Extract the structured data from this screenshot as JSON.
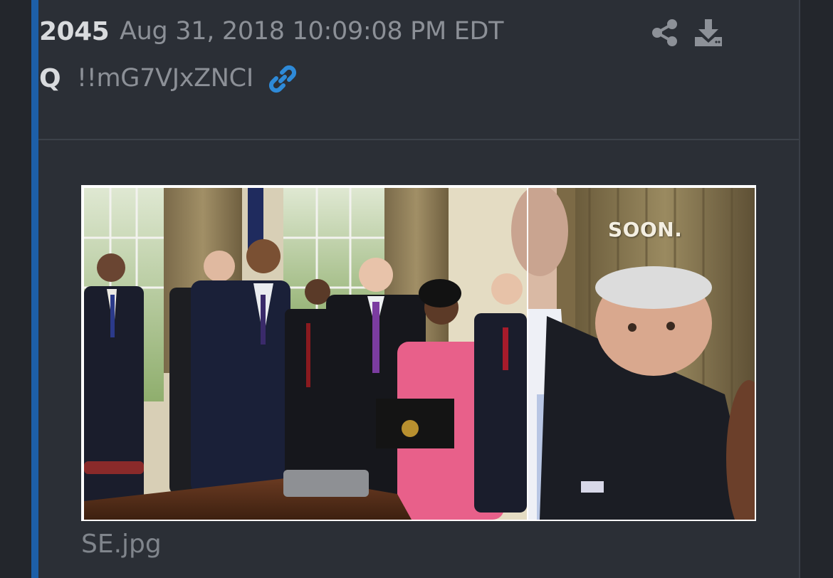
{
  "post": {
    "number": "2045",
    "date": "Aug 31, 2018 10:09:08 PM EDT",
    "author": "Q",
    "tripcode": "!!mG7VJxZNCI"
  },
  "icons": {
    "link": "link-icon",
    "share": "share-icon",
    "download": "download-icon"
  },
  "attachment": {
    "overlay_text": "SOON.",
    "filename": "SE.jpg"
  },
  "colors": {
    "background": "#23262c",
    "card": "#2b2f36",
    "accent": "#1d5fa8",
    "link_icon": "#2e8ad8",
    "muted_text": "#8c9097",
    "bright_text": "#d9dbde"
  }
}
